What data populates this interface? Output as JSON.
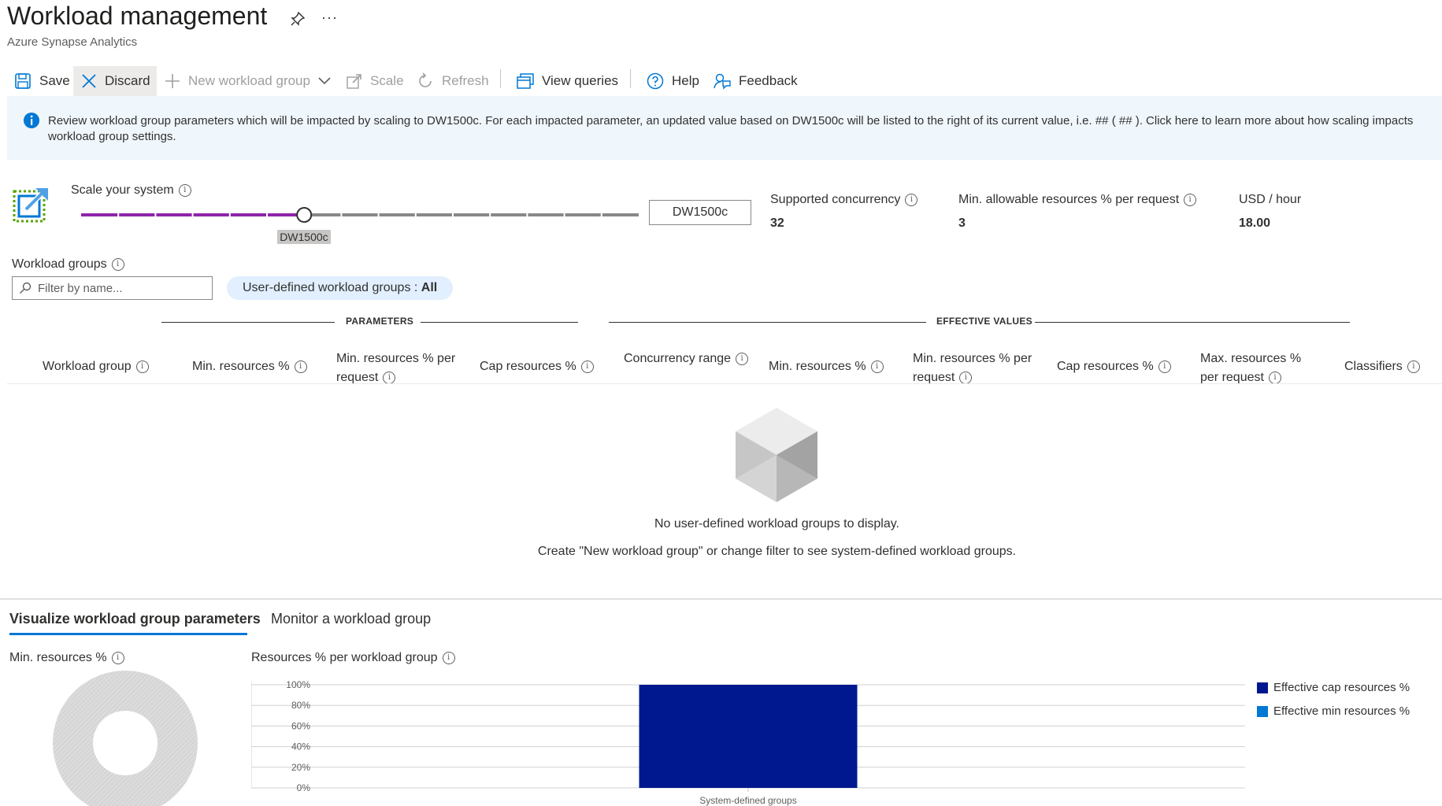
{
  "header": {
    "title": "Workload management",
    "subtitle": "Azure Synapse Analytics",
    "more_glyph": "···"
  },
  "toolbar": {
    "save_label": "Save",
    "discard_label": "Discard",
    "new_group_label": "New workload group",
    "scale_label": "Scale",
    "refresh_label": "Refresh",
    "view_queries_label": "View queries",
    "help_label": "Help",
    "feedback_label": "Feedback"
  },
  "banner": {
    "text": "Review workload group parameters which will be impacted by scaling to DW1500c. For each impacted parameter, an updated value based on DW1500c will be listed to the right of its current value, i.e. ## ( ## ). Click here to learn more about how scaling impacts workload group settings."
  },
  "scale": {
    "label": "Scale your system",
    "selected_sku": "DW1500c",
    "slider_tooltip": "DW1500c",
    "slider_position_fraction": 0.4,
    "slider_steps": 15,
    "supported_concurrency_label": "Supported concurrency",
    "supported_concurrency_value": "32",
    "min_allowable_label": "Min. allowable resources % per request",
    "min_allowable_value": "3",
    "usd_label": "USD / hour",
    "usd_value": "18.00"
  },
  "workload_groups": {
    "label": "Workload groups",
    "filter_placeholder": "Filter by name...",
    "pill_prefix": "User-defined workload groups : ",
    "pill_value": "All"
  },
  "table": {
    "parameters_label": "PARAMETERS",
    "effective_label": "EFFECTIVE VALUES",
    "columns": [
      "Workload group",
      "Min. resources %",
      "Min. resources % per request",
      "Cap resources %",
      "Concurrency range",
      "Min. resources %",
      "Min. resources % per request",
      "Cap resources %",
      "Max. resources % per request",
      "Classifiers"
    ],
    "empty_line1": "No user-defined workload groups to display.",
    "empty_line2": "Create \"New workload group\" or change filter to see system-defined workload groups."
  },
  "tabs": {
    "visualize": "Visualize workload group parameters",
    "monitor": "Monitor a workload group"
  },
  "charts": {
    "donut_label": "Min. resources %",
    "bar_label": "Resources % per workload group"
  },
  "colors": {
    "accent": "#0078d4",
    "slider_fill": "#8e24aa",
    "cap_series": "#00188f",
    "min_series": "#0078d4",
    "donut": "#d2d2d2"
  },
  "chart_data": {
    "type": "bar",
    "categories": [
      "System-defined groups"
    ],
    "series": [
      {
        "name": "Effective cap resources %",
        "values": [
          100
        ]
      },
      {
        "name": "Effective min resources %",
        "values": [
          0
        ]
      }
    ],
    "yticks": [
      "0%",
      "20%",
      "40%",
      "60%",
      "80%",
      "100%"
    ],
    "ylim": [
      0,
      100
    ],
    "grid": true,
    "legend": "right"
  }
}
